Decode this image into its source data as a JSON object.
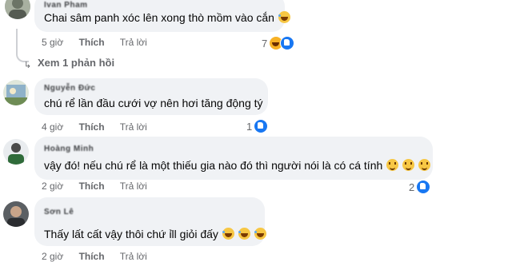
{
  "comments": [
    {
      "author": "Ivan Pham",
      "text": "Chai sâm panh xóc lên xong thò mồm vào cắn",
      "time": "5 giờ",
      "like_label": "Thích",
      "reply_label": "Trả lời",
      "reaction_count": "7",
      "reactions": [
        "like-icon",
        "haha-icon"
      ],
      "inline_emoji": [
        "laughing-emoji"
      ]
    },
    {
      "author": "Nguyễn Đức",
      "text": "chú rể lần đầu cưới vợ nên hơi tăng động tý",
      "time": "4 giờ",
      "like_label": "Thích",
      "reply_label": "Trả lời",
      "reaction_count": "1",
      "reactions": [
        "like-icon"
      ]
    },
    {
      "author": "Hoàng Minh",
      "text": "vậy đó! nếu chú rể là một thiếu gia nào đó thì người nói là có cá tính",
      "time": "2 giờ",
      "like_label": "Thích",
      "reply_label": "Trả lời",
      "reaction_count": "2",
      "reactions": [
        "like-icon"
      ],
      "inline_emoji": [
        "smile-emoji",
        "smile-emoji",
        "smile-emoji"
      ]
    },
    {
      "author": "Sơn Lê",
      "text": "Thấy lất cất vậy thôi chứ ỉll giỏi đấy",
      "time": "2 giờ",
      "like_label": "Thích",
      "reply_label": "Trả lời",
      "inline_emoji": [
        "laughing-emoji",
        "laughing-emoji",
        "laughing-emoji"
      ]
    }
  ],
  "view_replies_label": "Xem 1 phản hồi",
  "colors": {
    "bubble": "#f0f2f5",
    "meta_text": "#65676b",
    "like_blue": "#1877f2",
    "haha_yellow": "#f7b125"
  }
}
